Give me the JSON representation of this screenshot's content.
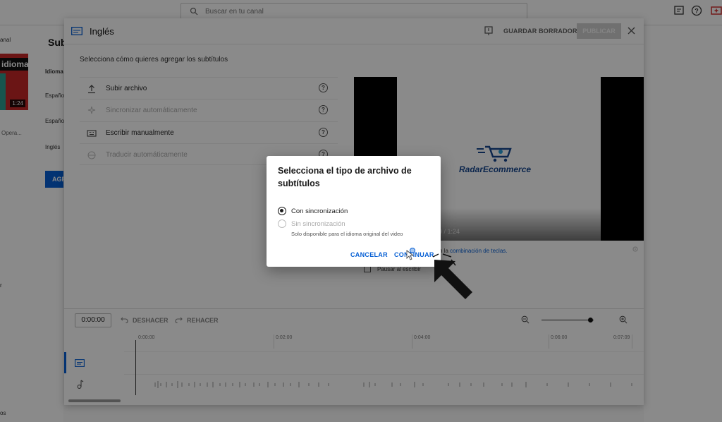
{
  "app": {
    "search_placeholder": "Buscar en tu canal",
    "left_sidebar": {
      "channel_text": "anal",
      "video_title_fragment": "idioma?",
      "video_duration": "1:24",
      "video_desc_fragment": "Opera...",
      "footer_fragment_1": "r",
      "footer_fragment_2": "os"
    },
    "subtitles_page": {
      "title_fragment": "Sub",
      "column_header": "Idioma",
      "languages": [
        "Españo",
        "Españo",
        "Inglés"
      ],
      "add_button": "AGR"
    }
  },
  "editor": {
    "title": "Inglés",
    "save_draft": "GUARDAR BORRADOR",
    "publish": "PUBLICAR",
    "heading": "Selecciona cómo quieres agregar los subtítulos",
    "options": [
      {
        "label": "Subir archivo",
        "icon": "upload-icon",
        "enabled": true
      },
      {
        "label": "Sincronizar automáticamente",
        "icon": "auto-sync-icon",
        "enabled": false
      },
      {
        "label": "Escribir manualmente",
        "icon": "keyboard-icon",
        "enabled": true
      },
      {
        "label": "Traducir automáticamente",
        "icon": "translate-icon",
        "enabled": false
      }
    ],
    "video": {
      "brand": "RadarEcommerce",
      "time_display": "0 / 1:24"
    },
    "shortcut_hint_prefix": "n la ",
    "shortcut_hint_link": "combinación de teclas.",
    "pause_while_typing": "Pausar al escribir",
    "timeline": {
      "timecode": "0:00:00",
      "undo": "DESHACER",
      "redo": "REHACER",
      "ruler": [
        "0:00:00",
        "0:02:00",
        "0:04:00",
        "0:06:00",
        "0:07:09"
      ]
    }
  },
  "modal": {
    "title": "Selecciona el tipo de archivo de subtítulos",
    "options": [
      {
        "label": "Con sincronización",
        "selected": true,
        "enabled": true
      },
      {
        "label": "Sin sincronización",
        "selected": false,
        "enabled": false,
        "note": "Solo disponible para el idioma original del video"
      }
    ],
    "cancel": "CANCELAR",
    "continue": "CONTINUAR"
  },
  "colors": {
    "accent": "#065fd4",
    "overlay": "rgba(0,0,0,0.46)"
  }
}
